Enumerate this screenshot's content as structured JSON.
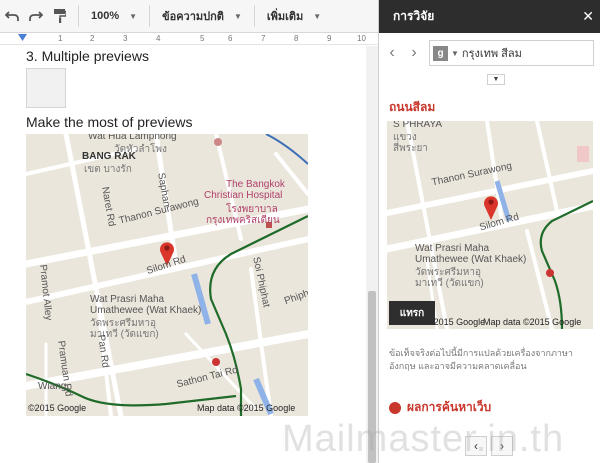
{
  "toolbar": {
    "zoom": "100%",
    "style": "ข้อความปกติ",
    "more": "เพิ่มเติม"
  },
  "ruler": {
    "ticks": [
      "1",
      "2",
      "3",
      "4",
      "5",
      "6",
      "7",
      "8",
      "9",
      "10"
    ]
  },
  "document": {
    "heading_previews": "3. Multiple previews",
    "heading_most": "Make the most of previews"
  },
  "map_main": {
    "labels": {
      "wat_rua": "Wat Hua Lamphong",
      "wat_rua_th": "วัดหัวลำโพง",
      "bang_rak": "BANG RAK",
      "bang_rak_th": "เขต บางรัก",
      "saphan": "Saphan",
      "naret": "Naret Rd",
      "hospital": "The Bangkok",
      "hospital2": "Christian Hospital",
      "hospital_th": "โรงพยาบาล",
      "hospital_th2": "กรุงเทพคริสเตียน",
      "thanon_surawong": "Thanon Surawong",
      "silom": "Silom Rd",
      "soi_phiphat": "Soi Phiphat",
      "phiphat": "Phiph",
      "pramot": "Pramot Alley",
      "wat_prasri": "Wat Prasri Maha",
      "umathewee": "Umathewee (Wat Khaek)",
      "wat_th1": "วัดพระศรีมหาอุ",
      "wat_th2": "มาเทวี (วัดแขก)",
      "pan_rd": "Pan Rd",
      "pramuan": "Pramuan Rd",
      "wiang": "Wiang",
      "sathon": "Sathon Tai Rd"
    },
    "copyright": "©2015 Google",
    "mapdata": "Map data ©2015 Google"
  },
  "panel": {
    "title": "การวิจัย",
    "close": "✕",
    "search_badge": "g",
    "search_query": "กรุงเทพ สีลม",
    "result_title": "ถนนสีลม",
    "map": {
      "s_phraya": "S PHRAYA",
      "khwaeng": "แขวง",
      "siphraya": "สี่พระยา",
      "thanon_surawong": "Thanon Surawong",
      "silom": "Silom Rd",
      "wat_prasri": "Wat Prasri Maha",
      "umathewee": "Umathewee (Wat Khaek)",
      "wat_th1": "วัดพระศรีมหาอุ",
      "wat_th2": "มาเทวี (วัดแขก)",
      "copyright": "©2015 Google",
      "mapdata": "Map data ©2015 Google"
    },
    "insert": "แทรก",
    "disclaimer": "ข้อเท็จจริงต่อไปนี้มีการแปลด้วยเครื่องจากภาษาอังกฤษ และอาจมีความคลาดเคลื่อน",
    "web_results": "ผลการค้นหาเว็บ"
  },
  "watermark": "Mailmaster.in.th",
  "colors": {
    "accent_red": "#c8362c",
    "panel_header": "#2d2d2d",
    "map_bg": "#ebe6dc"
  }
}
